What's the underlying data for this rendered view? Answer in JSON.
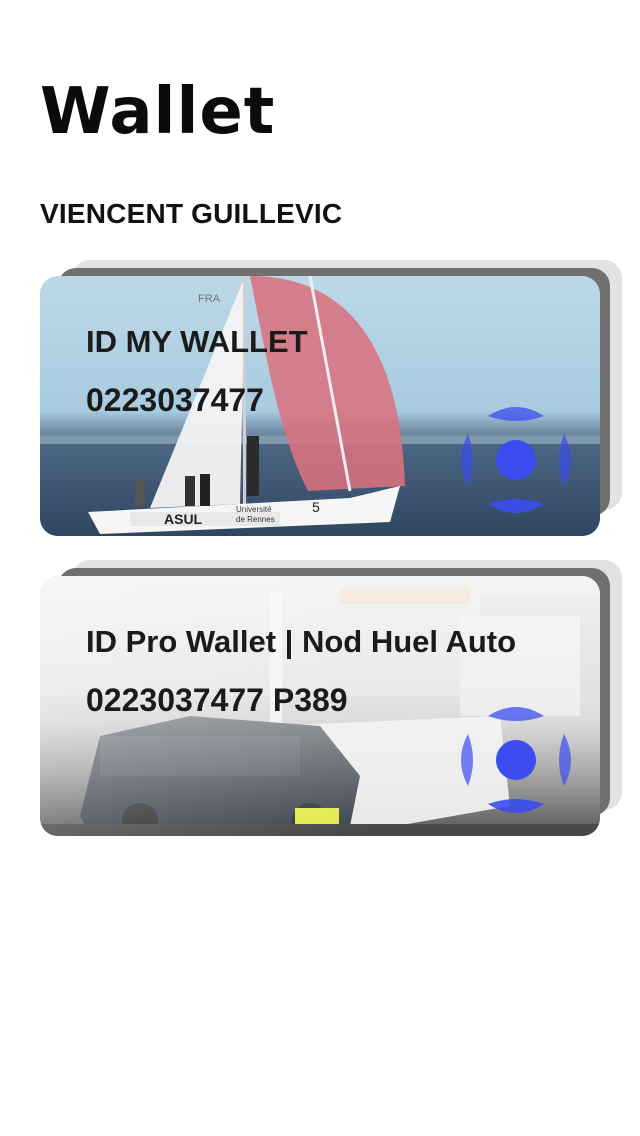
{
  "header": {
    "title": "Wallet"
  },
  "user": {
    "name": "VIENCENT GUILLEVIC"
  },
  "cards": [
    {
      "title": "ID MY WALLET",
      "number": "0223037477",
      "photo": "sailboat-photo",
      "icon": "wallet-logo-icon"
    },
    {
      "title": "ID Pro Wallet | Nod Huel Auto",
      "number": "0223037477 P389",
      "photo": "tow-truck-photo",
      "icon": "wallet-logo-icon"
    }
  ],
  "colors": {
    "background": "#ffffff",
    "text": "#111111",
    "accent": "#3b4cf0",
    "stack_dark": "#707070",
    "stack_light": "#e2e2e2"
  }
}
